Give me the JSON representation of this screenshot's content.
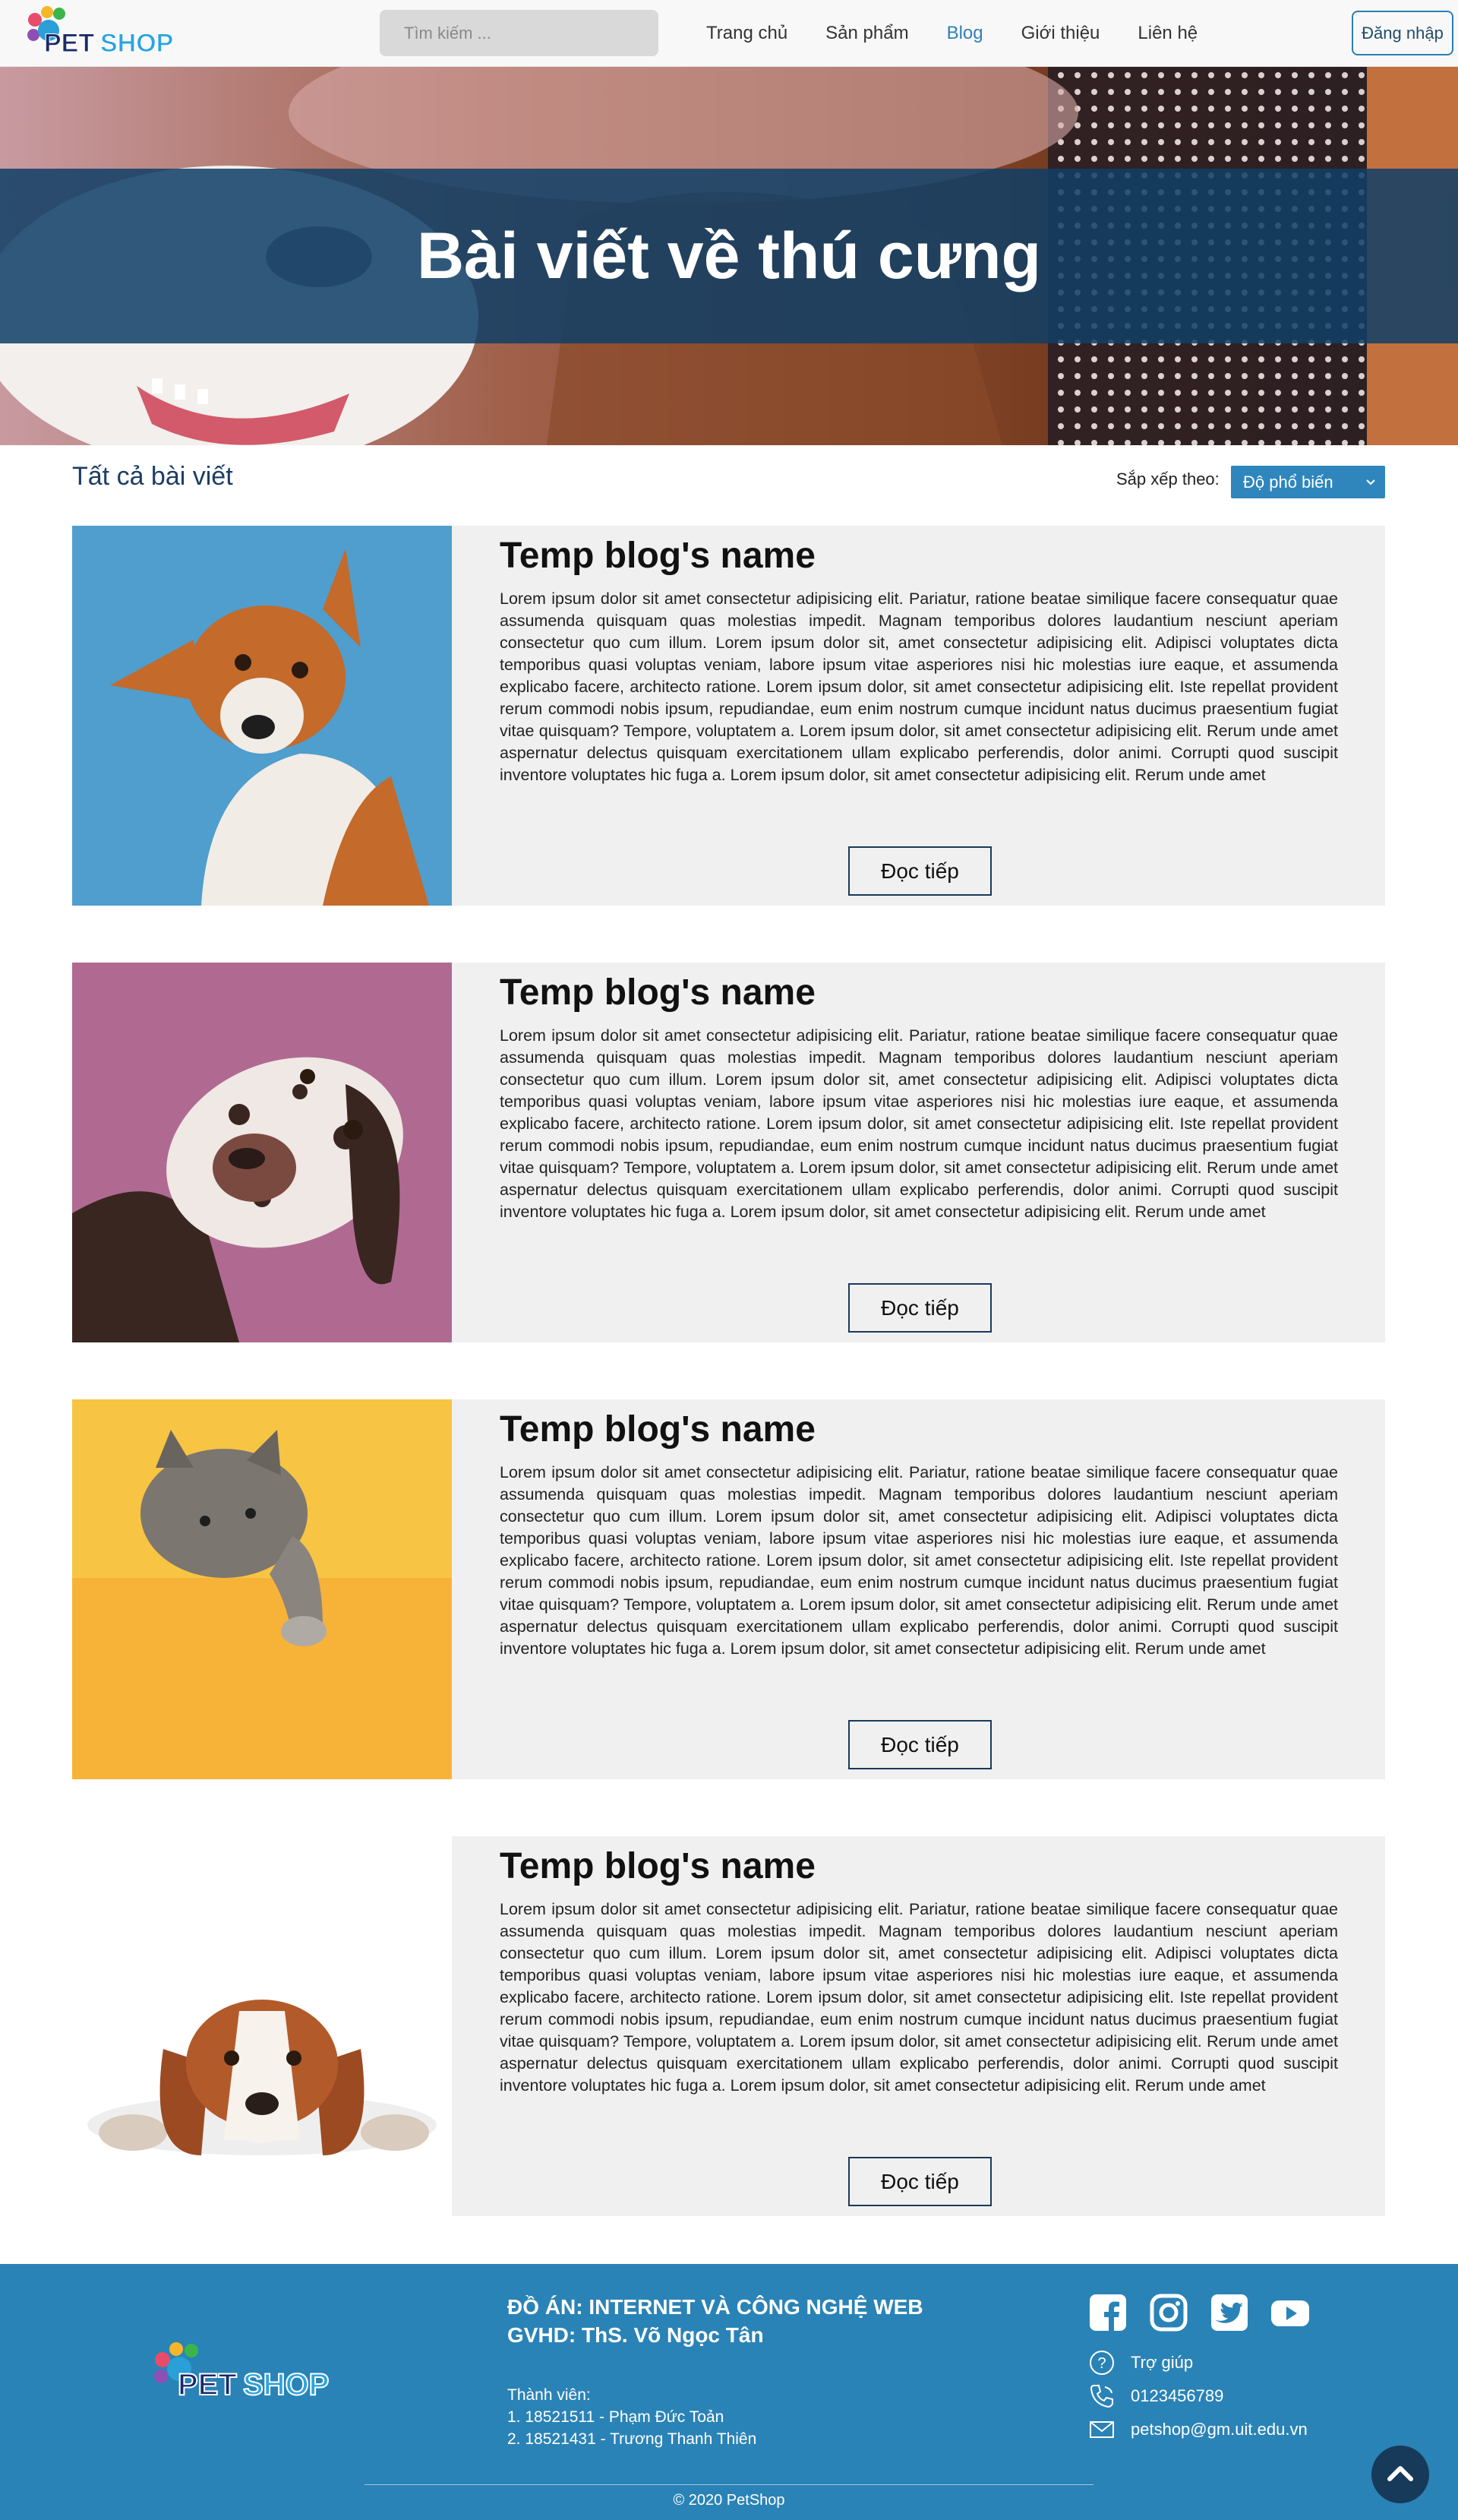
{
  "header": {
    "logo_text": "PETSHOP",
    "search_placeholder": "Tìm kiếm ...",
    "nav": [
      {
        "label": "Trang chủ",
        "active": false
      },
      {
        "label": "Sản phẩm",
        "active": false
      },
      {
        "label": "Blog",
        "active": true
      },
      {
        "label": "Giới thiệu",
        "active": false
      },
      {
        "label": "Liên hệ",
        "active": false
      }
    ],
    "login_label": "Đăng nhập"
  },
  "hero": {
    "title": "Bài viết về thú cưng"
  },
  "section": {
    "title": "Tất cả bài viết",
    "sort_label": "Sắp xếp theo:",
    "sort_value": "Độ phổ biến"
  },
  "posts": [
    {
      "image": "dog-tilted-head-blue-background",
      "title": "Temp blog's name",
      "excerpt": "Lorem ipsum dolor sit amet consectetur adipisicing elit. Pariatur, ratione beatae similique facere consequatur quae assumenda quisquam quas molestias impedit. Magnam temporibus dolores laudantium nesciunt aperiam consectetur quo cum illum. Lorem ipsum dolor sit, amet consectetur adipisicing elit. Adipisci voluptates dicta temporibus quasi voluptas veniam, labore ipsum vitae asperiores nisi hic molestias iure eaque, et assumenda explicabo facere, architecto ratione. Lorem ipsum dolor, sit amet consectetur adipisicing elit. Iste repellat provident rerum commodi nobis ipsum, repudiandae, eum enim nostrum cumque incidunt natus ducimus praesentium fugiat vitae quisquam? Tempore, voluptatem a. Lorem ipsum dolor, sit amet consectetur adipisicing elit. Rerum unde amet aspernatur delectus quisquam exercitationem ullam explicabo perferendis, dolor animi. Corrupti quod suscipit inventore voluptates hic fuga a. Lorem ipsum dolor, sit amet consectetur adipisicing elit. Rerum unde amet",
      "read_more": "Đọc tiếp"
    },
    {
      "image": "dalmatian-dog-pink-background",
      "title": "Temp blog's name",
      "excerpt": "Lorem ipsum dolor sit amet consectetur adipisicing elit. Pariatur, ratione beatae similique facere consequatur quae assumenda quisquam quas molestias impedit. Magnam temporibus dolores laudantium nesciunt aperiam consectetur quo cum illum. Lorem ipsum dolor sit, amet consectetur adipisicing elit. Adipisci voluptates dicta temporibus quasi voluptas veniam, labore ipsum vitae asperiores nisi hic molestias iure eaque, et assumenda explicabo facere, architecto ratione. Lorem ipsum dolor, sit amet consectetur adipisicing elit. Iste repellat provident rerum commodi nobis ipsum, repudiandae, eum enim nostrum cumque incidunt natus ducimus praesentium fugiat vitae quisquam? Tempore, voluptatem a. Lorem ipsum dolor, sit amet consectetur adipisicing elit. Rerum unde amet aspernatur delectus quisquam exercitationem ullam explicabo perferendis, dolor animi. Corrupti quod suscipit inventore voluptates hic fuga a. Lorem ipsum dolor, sit amet consectetur adipisicing elit. Rerum unde amet",
      "read_more": "Đọc tiếp"
    },
    {
      "image": "grey-kitten-yellow-background",
      "title": "Temp blog's name",
      "excerpt": "Lorem ipsum dolor sit amet consectetur adipisicing elit. Pariatur, ratione beatae similique facere consequatur quae assumenda quisquam quas molestias impedit. Magnam temporibus dolores laudantium nesciunt aperiam consectetur quo cum illum. Lorem ipsum dolor sit, amet consectetur adipisicing elit. Adipisci voluptates dicta temporibus quasi voluptas veniam, labore ipsum vitae asperiores nisi hic molestias iure eaque, et assumenda explicabo facere, architecto ratione. Lorem ipsum dolor, sit amet consectetur adipisicing elit. Iste repellat provident rerum commodi nobis ipsum, repudiandae, eum enim nostrum cumque incidunt natus ducimus praesentium fugiat vitae quisquam? Tempore, voluptatem a. Lorem ipsum dolor, sit amet consectetur adipisicing elit. Rerum unde amet aspernatur delectus quisquam exercitationem ullam explicabo perferendis, dolor animi. Corrupti quod suscipit inventore voluptates hic fuga a. Lorem ipsum dolor, sit amet consectetur adipisicing elit. Rerum unde amet",
      "read_more": "Đọc tiếp"
    },
    {
      "image": "beagle-lying-white-background",
      "title": "Temp blog's name",
      "excerpt": "Lorem ipsum dolor sit amet consectetur adipisicing elit. Pariatur, ratione beatae similique facere consequatur quae assumenda quisquam quas molestias impedit. Magnam temporibus dolores laudantium nesciunt aperiam consectetur quo cum illum. Lorem ipsum dolor sit, amet consectetur adipisicing elit. Adipisci voluptates dicta temporibus quasi voluptas veniam, labore ipsum vitae asperiores nisi hic molestias iure eaque, et assumenda explicabo facere, architecto ratione. Lorem ipsum dolor, sit amet consectetur adipisicing elit. Iste repellat provident rerum commodi nobis ipsum, repudiandae, eum enim nostrum cumque incidunt natus ducimus praesentium fugiat vitae quisquam? Tempore, voluptatem a. Lorem ipsum dolor, sit amet consectetur adipisicing elit. Rerum unde amet aspernatur delectus quisquam exercitationem ullam explicabo perferendis, dolor animi. Corrupti quod suscipit inventore voluptates hic fuga a. Lorem ipsum dolor, sit amet consectetur adipisicing elit. Rerum unde amet",
      "read_more": "Đọc tiếp"
    }
  ],
  "footer": {
    "logo_text": "PETSHOP",
    "project_line": "ĐỒ ÁN: INTERNET VÀ CÔNG NGHỆ WEB",
    "advisor_line": "GVHD: ThS. Võ Ngọc Tân",
    "members_label": "Thành viên:",
    "members": [
      "1. 18521511 - Phạm Đức Toản",
      "2. 18521431 - Trương Thanh Thiên"
    ],
    "social_icons": [
      "facebook-icon",
      "instagram-icon",
      "twitter-icon",
      "youtube-icon"
    ],
    "help_label": "Trợ giúp",
    "phone": "0123456789",
    "email": "petshop@gm.uit.edu.vn",
    "copyright": "© 2020 PetShop"
  },
  "colors": {
    "accent": "#2f86bd",
    "hero_band": "#103f66",
    "footer": "#2a83b6",
    "card_bg": "#f0f0f0"
  }
}
